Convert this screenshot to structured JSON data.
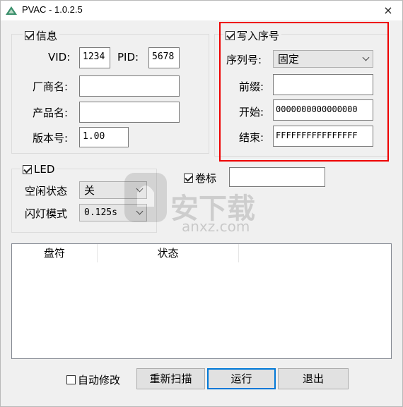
{
  "window": {
    "title": "PVAC - 1.0.2.5",
    "close_icon": "×"
  },
  "info_group": {
    "label": "信息",
    "checked": true,
    "vid_label": "VID:",
    "vid_value": "1234",
    "pid_label": "PID:",
    "pid_value": "5678",
    "vendor_label": "厂商名:",
    "vendor_value": "",
    "product_label": "产品名:",
    "product_value": "",
    "version_label": "版本号:",
    "version_value": "1.00"
  },
  "serial_group": {
    "label": "写入序号",
    "checked": true,
    "serial_label": "序列号:",
    "serial_mode": "固定",
    "prefix_label": "前缀:",
    "prefix_value": "",
    "start_label": "开始:",
    "start_value": "0000000000000000",
    "end_label": "结束:",
    "end_value": "FFFFFFFFFFFFFFFF"
  },
  "led_group": {
    "label": "LED",
    "checked": true,
    "idle_label": "空闲状态",
    "idle_value": "关",
    "blink_label": "闪灯模式",
    "blink_value": "0.125s"
  },
  "volume_label": {
    "label": "卷标",
    "checked": true,
    "value": ""
  },
  "list": {
    "columns": [
      "盘符",
      "状态"
    ]
  },
  "footer": {
    "auto_modify_label": "自动修改",
    "auto_modify_checked": false,
    "rescan_label": "重新扫描",
    "run_label": "运行",
    "exit_label": "退出"
  },
  "watermark": {
    "text": "安下载",
    "sub": "anxz.com"
  },
  "colors": {
    "highlight": "#e00000",
    "default_button_border": "#0078d7"
  }
}
